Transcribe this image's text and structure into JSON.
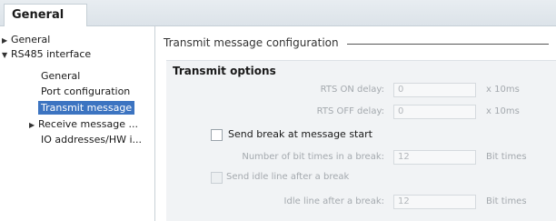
{
  "tab": {
    "label": "General"
  },
  "nav": {
    "items": [
      {
        "label": "General",
        "arrow": "▶"
      },
      {
        "label": "RS485 interface",
        "arrow": "▼"
      },
      {
        "label": "General"
      },
      {
        "label": "Port configuration"
      },
      {
        "label": "Transmit message"
      },
      {
        "label": "Receive message ...",
        "arrow": "▶"
      },
      {
        "label": "IO addresses/HW i..."
      }
    ]
  },
  "section": {
    "title": "Transmit message configuration"
  },
  "transmit_options": {
    "title": "Transmit options",
    "rts_on": {
      "label": "RTS ON delay:",
      "value": "0",
      "unit": "x 10ms"
    },
    "rts_off": {
      "label": "RTS OFF delay:",
      "value": "0",
      "unit": "x 10ms"
    },
    "send_break": {
      "label": "Send break at message start",
      "checked": false
    },
    "break_bits": {
      "label": "Number of bit times in a break:",
      "value": "12",
      "unit": "Bit times"
    },
    "send_idle": {
      "label": "Send idle line after a break",
      "checked": false
    },
    "idle_line": {
      "label": "Idle line after a break:",
      "value": "12",
      "unit": "Bit times"
    }
  },
  "colors": {
    "selection": "#3c74c1",
    "panel": "#f1f3f5",
    "disabled_text": "#a4a9ae"
  }
}
